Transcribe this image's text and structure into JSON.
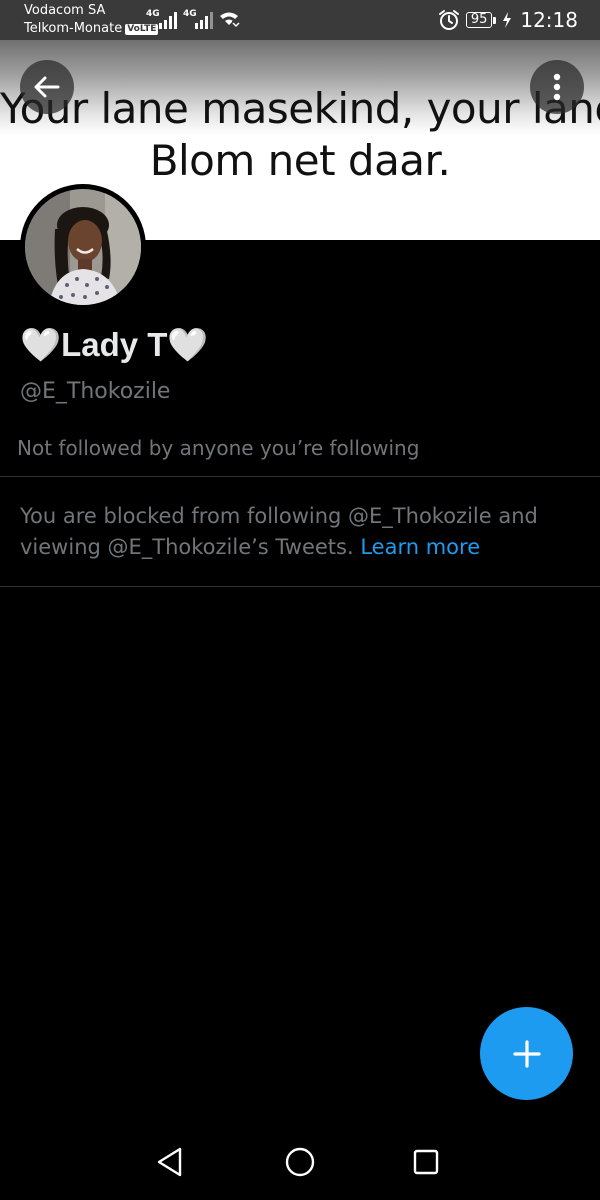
{
  "status_bar": {
    "carrier_1": "Vodacom SA",
    "carrier_2": "Telkom-Monate",
    "volte_label": "VoLTE",
    "network_1": "4G",
    "network_2": "4G",
    "battery_level": "95",
    "time": "12:18",
    "icons": [
      "signal-icon",
      "signal-icon",
      "wifi-calling-icon",
      "alarm-icon",
      "battery-icon",
      "charging-icon"
    ]
  },
  "banner": {
    "line_1": "Your lane masekind, your lane!",
    "line_2": "Blom net daar."
  },
  "header": {
    "back_icon": "arrow-left-icon",
    "more_icon": "more-vertical-icon"
  },
  "profile": {
    "display_name": "🤍Lady T🤍",
    "handle": "@E_Thokozile",
    "followed_by_text": "Not followed by anyone you’re following",
    "blocked_text": "You are blocked from following @E_Thokozile and viewing @E_Thokozile’s Tweets.",
    "learn_more": "Learn more"
  },
  "fab": {
    "icon": "plus-icon"
  },
  "nav_bar": {
    "icons": [
      "triangle-back-icon",
      "circle-home-icon",
      "square-recents-icon"
    ]
  },
  "colors": {
    "accent": "#1d9bf0",
    "background": "#000000",
    "primary_text": "#e7e9ea",
    "secondary_text": "#71767b",
    "divider": "#2f3336"
  }
}
